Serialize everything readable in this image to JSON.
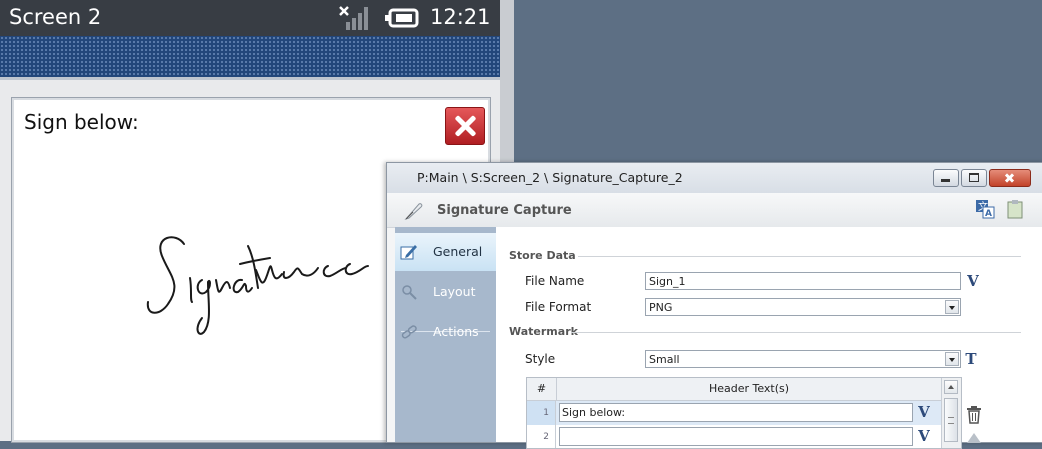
{
  "device": {
    "screen_title": "Screen 2",
    "time": "12:21",
    "signature_prompt": "Sign below:"
  },
  "dialog": {
    "path": "P:Main \\ S:Screen_2 \\ Signature_Capture_2",
    "header_title": "Signature Capture",
    "nav": [
      {
        "label": "General",
        "icon": "pencil-edit-icon",
        "active": true
      },
      {
        "label": "Layout",
        "icon": "layout-icon",
        "active": false
      },
      {
        "label": "Actions",
        "icon": "link-icon",
        "active": false
      }
    ],
    "store_data": {
      "section_title": "Store Data",
      "file_name_label": "File Name",
      "file_name_value": "Sign_1",
      "file_format_label": "File Format",
      "file_format_value": "PNG"
    },
    "watermark": {
      "section_title": "Watermark",
      "style_label": "Style",
      "style_value": "Small",
      "table": {
        "col_num": "#",
        "col_text": "Header Text(s)",
        "rows": [
          {
            "num": "1",
            "text": "Sign below:"
          },
          {
            "num": "2",
            "text": ""
          }
        ]
      }
    },
    "variable_button_label": "V",
    "text_button_label": "T"
  },
  "colors": {
    "desktop": "#5d6f84",
    "statusbar": "#383d44",
    "nav_panel": "#a7b8cc",
    "close_red": "#c93034",
    "accent_blue": "#2d4a7a"
  }
}
